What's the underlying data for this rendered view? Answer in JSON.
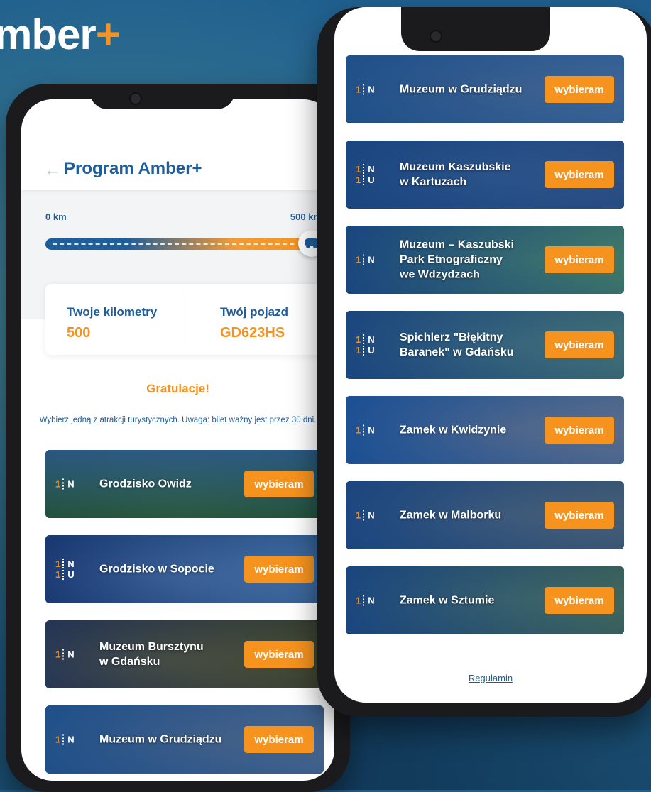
{
  "brand": {
    "text": "mber",
    "plus": "+"
  },
  "left": {
    "header": {
      "title": "Program Amber+",
      "back": "←"
    },
    "slider": {
      "min_label": "0 km",
      "max_label": "500 km",
      "progress": 1.0
    },
    "card": {
      "km_label": "Twoje kilometry",
      "km_value": "500",
      "vehicle_label": "Twój pojazd",
      "vehicle_value": "GD623HS"
    },
    "congrats": "Gratulacje!",
    "instructions": "Wybierz jedną z atrakcji turystycznych. Uwaga: bilet ważny jest przez 30 dni.",
    "tiles": [
      {
        "name": "Grodzisko Owidz",
        "badge": [
          [
            "1",
            "N"
          ]
        ],
        "button": "wybieram"
      },
      {
        "name": "Grodzisko w Sopocie",
        "badge": [
          [
            "1",
            "N"
          ],
          [
            "1",
            "U"
          ]
        ],
        "button": "wybieram"
      },
      {
        "name": "Muzeum Bursztynu\nw Gdańsku",
        "badge": [
          [
            "1",
            "N"
          ]
        ],
        "button": "wybieram"
      },
      {
        "name": "Muzeum w Grudziądzu",
        "badge": [
          [
            "1",
            "N"
          ]
        ],
        "button": "wybieram"
      }
    ]
  },
  "right": {
    "tiles": [
      {
        "name": "Muzeum w Grudziądzu",
        "badge": [
          [
            "1",
            "N"
          ]
        ],
        "button": "wybieram"
      },
      {
        "name": "Muzeum Kaszubskie\nw Kartuzach",
        "badge": [
          [
            "1",
            "N"
          ],
          [
            "1",
            "U"
          ]
        ],
        "button": "wybieram"
      },
      {
        "name": "Muzeum – Kaszubski\nPark Etnograficzny\nwe Wdzydzach",
        "badge": [
          [
            "1",
            "N"
          ]
        ],
        "button": "wybieram"
      },
      {
        "name": "Spichlerz \"Błękitny\nBaranek\" w Gdańsku",
        "badge": [
          [
            "1",
            "N"
          ],
          [
            "1",
            "U"
          ]
        ],
        "button": "wybieram"
      },
      {
        "name": "Zamek w Kwidzynie",
        "badge": [
          [
            "1",
            "N"
          ]
        ],
        "button": "wybieram"
      },
      {
        "name": "Zamek w Malborku",
        "badge": [
          [
            "1",
            "N"
          ]
        ],
        "button": "wybieram"
      },
      {
        "name": "Zamek w Sztumie",
        "badge": [
          [
            "1",
            "N"
          ]
        ],
        "button": "wybieram"
      }
    ],
    "footer_link": "Regulamin"
  },
  "colors": {
    "primary": "#1f5e9a",
    "accent": "#f6921e"
  }
}
